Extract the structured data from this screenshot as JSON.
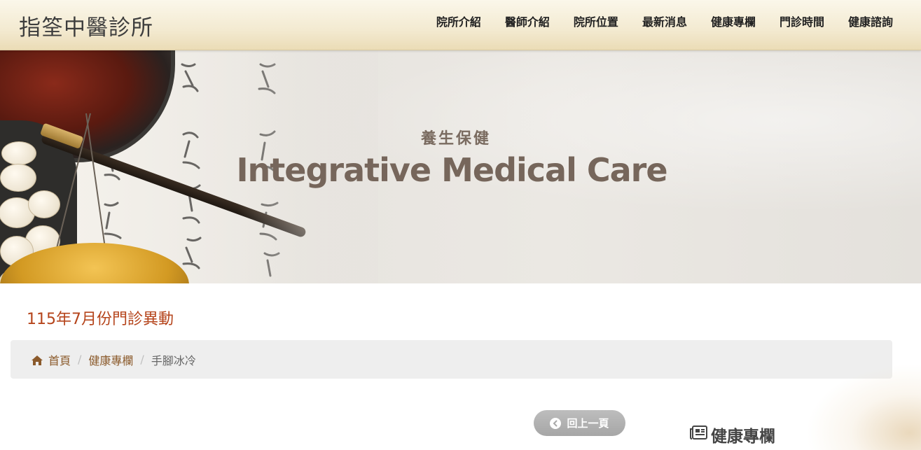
{
  "header": {
    "logo": "指筌中醫診所",
    "nav": [
      {
        "label": "院所介紹"
      },
      {
        "label": "醫師介紹"
      },
      {
        "label": "院所位置"
      },
      {
        "label": "最新消息"
      },
      {
        "label": "健康專欄"
      },
      {
        "label": "門診時間"
      },
      {
        "label": "健康諮詢"
      }
    ]
  },
  "hero": {
    "subtitle": "養生保健",
    "title": "Integrative Medical Care"
  },
  "page": {
    "title": "115年7月份門診異動"
  },
  "breadcrumb": {
    "home": "首頁",
    "section": "健康專欄",
    "current": "手腳冰冷",
    "separator": "/"
  },
  "actions": {
    "back_label": "回上一頁"
  },
  "sidebar": {
    "heading": "健康專欄"
  },
  "colors": {
    "accent": "#b5441b",
    "link": "#8b5a2b",
    "hero_text": "#76665b"
  },
  "icons": {
    "home": "home-icon",
    "back": "chevron-left-circle-icon",
    "newspaper": "newspaper-icon"
  }
}
